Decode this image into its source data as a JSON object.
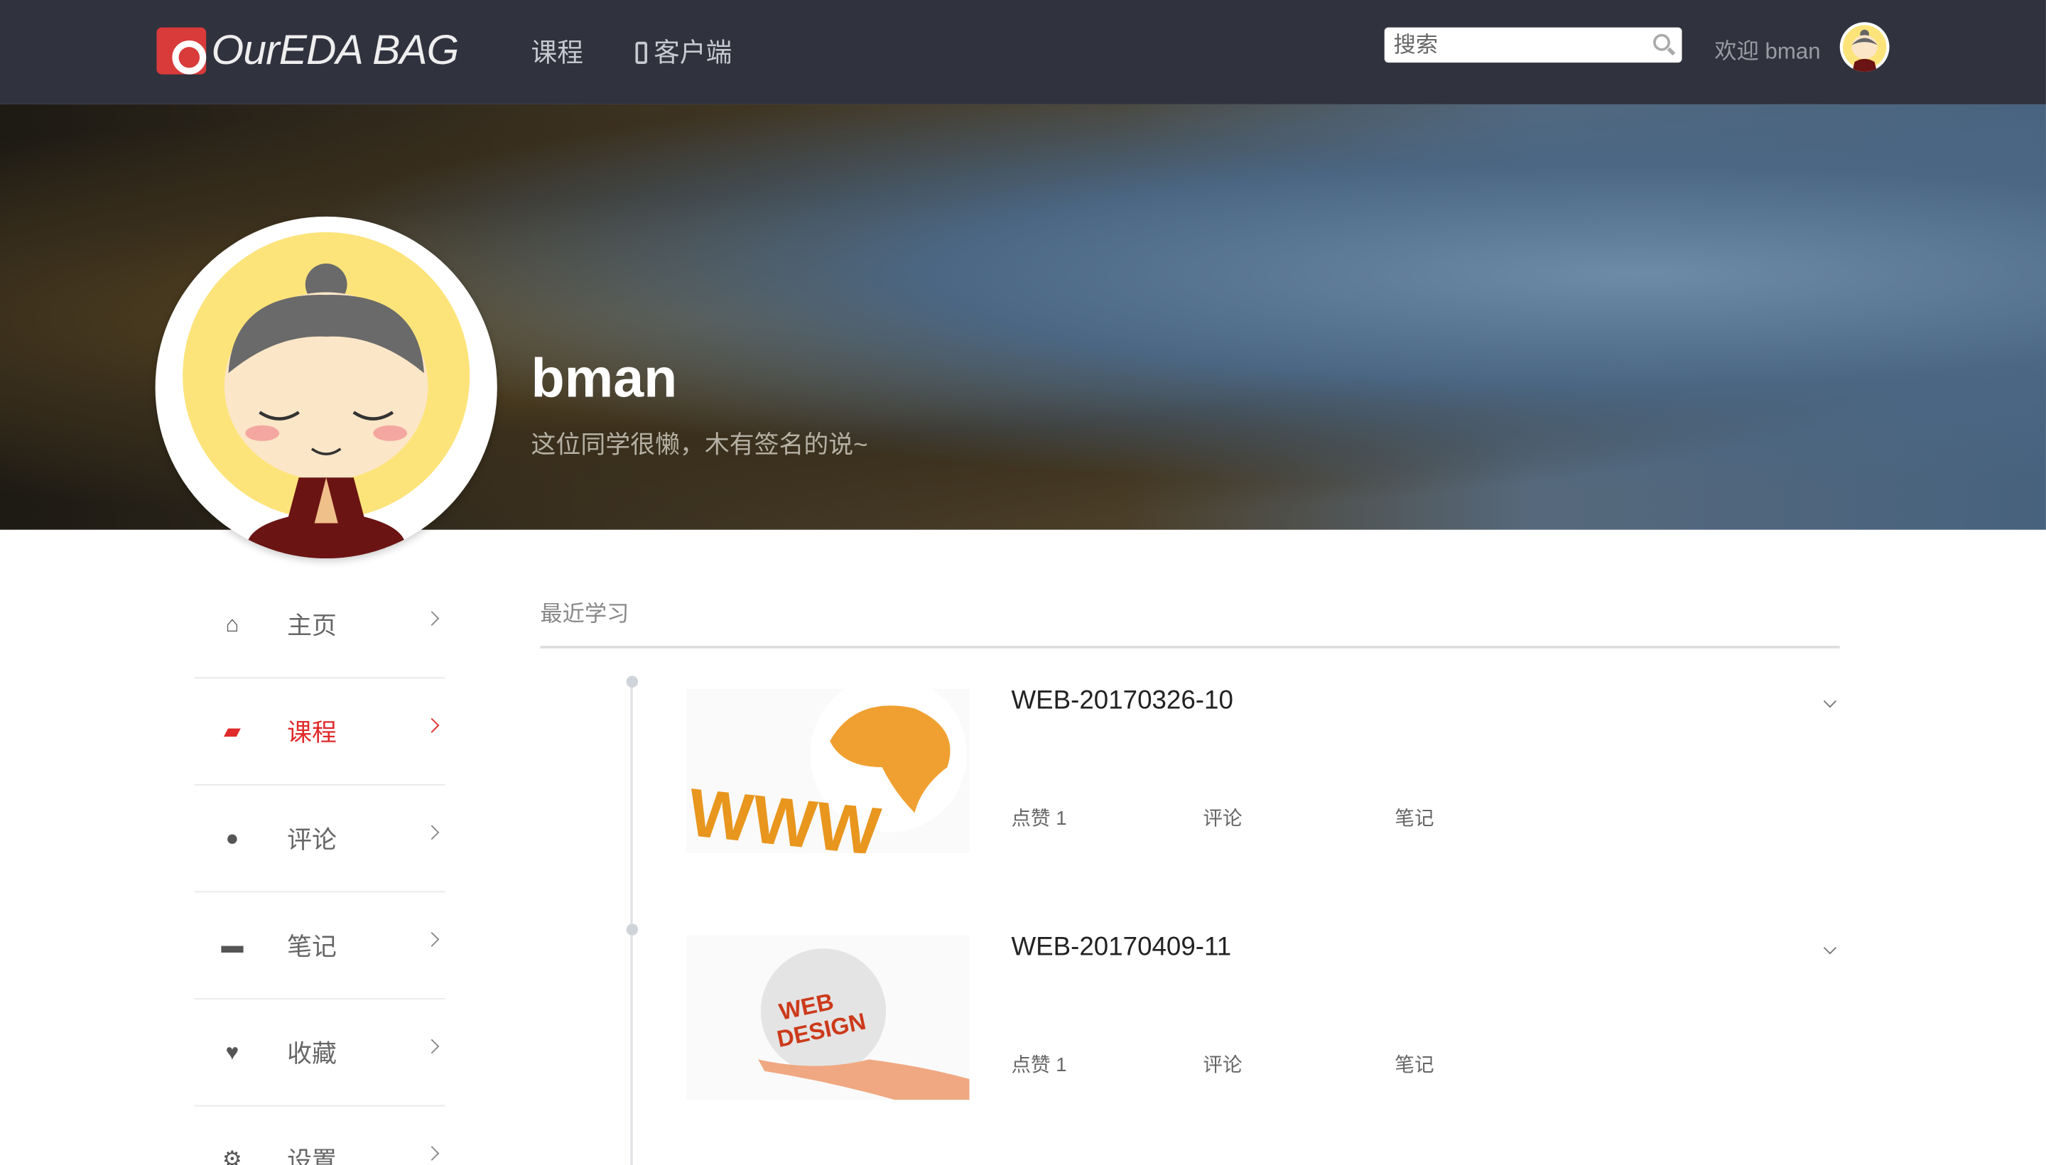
{
  "nav": {
    "brand": "OurEDA BAG",
    "links": [
      "课程",
      "客户端"
    ],
    "search_placeholder": "搜索",
    "welcome": "欢迎 bman"
  },
  "profile": {
    "name": "bman",
    "signature": "这位同学很懒，木有签名的说~"
  },
  "sidebar": {
    "items": [
      {
        "label": "主页",
        "icon": "home-icon"
      },
      {
        "label": "课程",
        "icon": "book-icon",
        "active": true
      },
      {
        "label": "评论",
        "icon": "comment-icon"
      },
      {
        "label": "笔记",
        "icon": "briefcase-icon"
      },
      {
        "label": "收藏",
        "icon": "heart-icon"
      },
      {
        "label": "设置",
        "icon": "gear-icon"
      }
    ]
  },
  "main": {
    "section_title": "最近学习",
    "courses": [
      {
        "title": "WEB-20170326-10",
        "likes": "点赞 1",
        "comments": "评论",
        "notes": "笔记"
      },
      {
        "title": "WEB-20170409-11",
        "likes": "点赞 1",
        "comments": "评论",
        "notes": "笔记"
      }
    ]
  },
  "colors": {
    "nav_bg": "#30323e",
    "accent": "#e02a2a"
  }
}
